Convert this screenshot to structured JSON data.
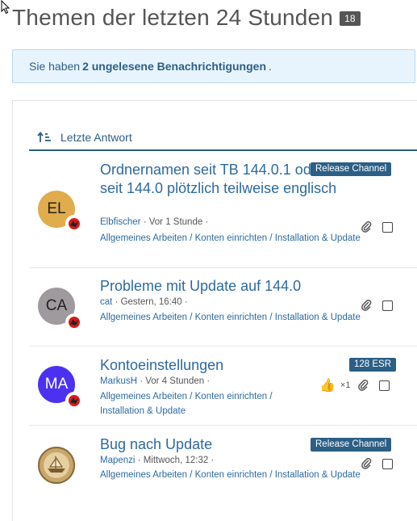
{
  "header": {
    "title": "Themen der letzten 24 Stunden",
    "count": "18"
  },
  "notice": {
    "prefix": "Sie haben",
    "bold": "2 ungelesene Benachrichtigungen",
    "suffix": "."
  },
  "sort": {
    "label": "Letzte Antwort"
  },
  "topics": [
    {
      "title": "Ordnernamen seit TB 144.0.1 oder schon seit 144.0 plötzlich teilweise englisch",
      "author": "Elbfischer",
      "time": "Vor 1 Stunde",
      "categories": "Allgemeines Arbeiten / Konten einrichten / Installation & Update",
      "label": "Release Channel",
      "avatar_initials": "EL",
      "avatar_color": "#e0ac4c"
    },
    {
      "title": "Probleme mit Update auf 144.0",
      "author": "cat",
      "time": "Gestern, 16:40",
      "categories": "Allgemeines Arbeiten / Konten einrichten / Installation & Update",
      "label": "",
      "avatar_initials": "CA",
      "avatar_color": "#9e9a9e"
    },
    {
      "title": "Kontoeinstellungen",
      "author": "MarkusH",
      "time": "Vor 4 Stunden",
      "categories": "Allgemeines Arbeiten / Konten einrichten / Installation & Update",
      "label": "128 ESR",
      "likes": "×1",
      "avatar_initials": "MA",
      "avatar_color": "#4c32f0"
    },
    {
      "title": "Bug nach Update",
      "author": "Mapenzi",
      "time": "Mittwoch, 12:32",
      "categories": "Allgemeines Arbeiten / Konten einrichten / Installation & Update",
      "label": "Release Channel",
      "avatar_initials": "",
      "avatar_color": "#c9a66b"
    }
  ]
}
